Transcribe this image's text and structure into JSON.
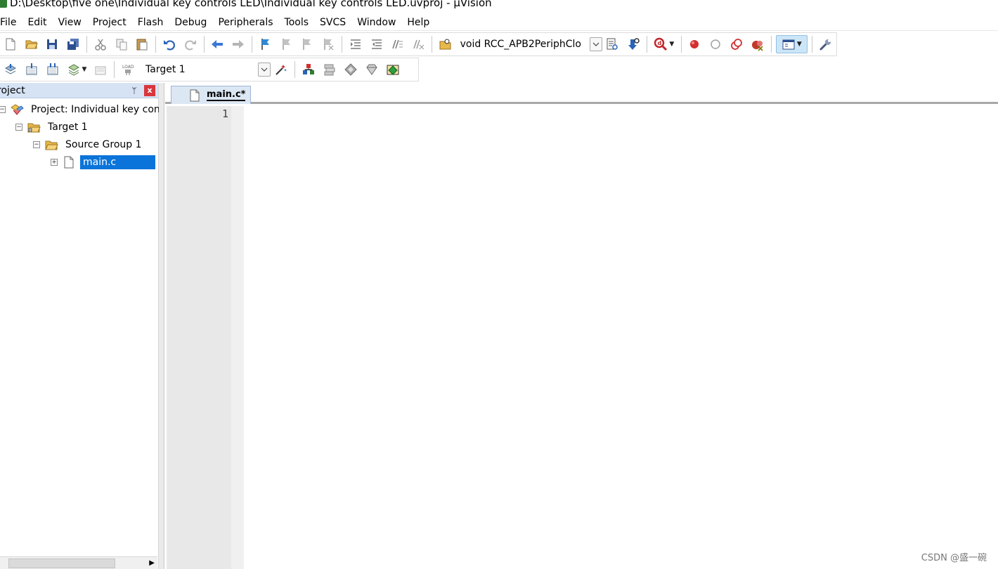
{
  "window": {
    "title": "D:\\Desktop\\five one\\Individual key controls LED\\Individual key controls LED.uvproj - µVision"
  },
  "menu": [
    "File",
    "Edit",
    "View",
    "Project",
    "Flash",
    "Debug",
    "Peripherals",
    "Tools",
    "SVCS",
    "Window",
    "Help"
  ],
  "toolbar": {
    "function_combo": "void RCC_APB2PeriphClo",
    "target_combo": "Target 1"
  },
  "project_panel": {
    "title": "roject",
    "pin_glyph": "ᛘ",
    "close_glyph": "x",
    "tree": {
      "project": "Project: Individual key cont",
      "target": "Target 1",
      "group": "Source Group 1",
      "file": "main.c"
    },
    "expander_minus": "−",
    "expander_plus": "+"
  },
  "editor": {
    "tab_label": "main.c*",
    "line_numbers": [
      "1"
    ]
  },
  "watermark": "CSDN @盛一碗",
  "colors": {
    "selection": "#0a74da",
    "panel_header": "#d6e3f5",
    "tab_active": "#dce7f4"
  }
}
